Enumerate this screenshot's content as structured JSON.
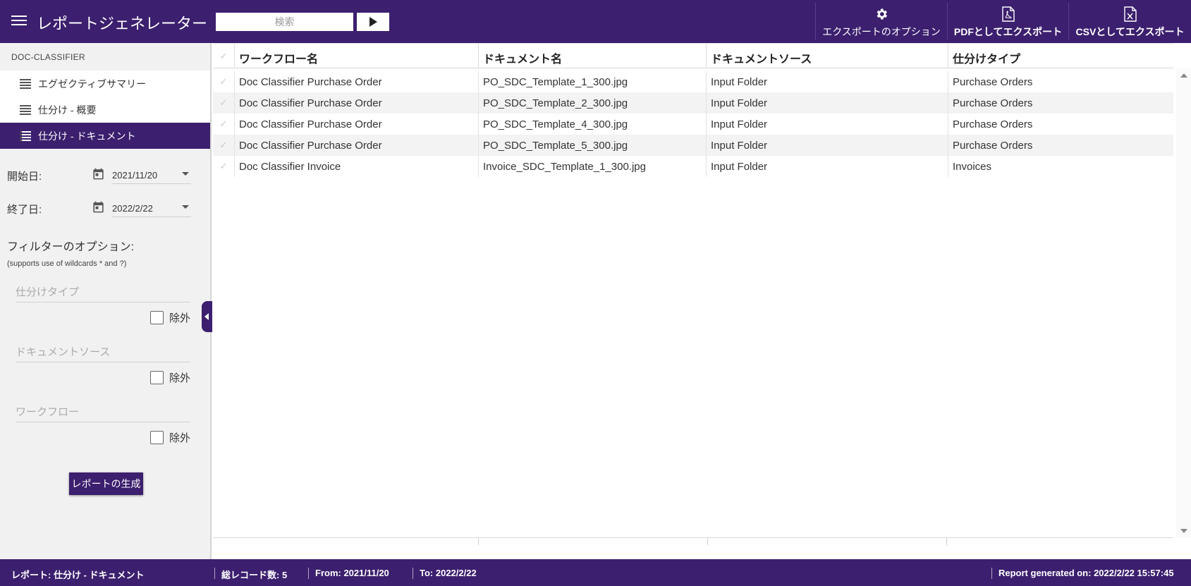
{
  "header": {
    "title": "レポートジェネレーター",
    "search_placeholder": "検索",
    "export_options_label": "エクスポートのオプション",
    "export_pdf_label": "PDFとしてエクスポート",
    "export_csv_label": "CSVとしてエクスポート"
  },
  "sidebar": {
    "section_label": "DOC-CLASSIFIER",
    "items": [
      {
        "label": "エグゼクティブサマリー"
      },
      {
        "label": "仕分け - 概要"
      },
      {
        "label": "仕分け - ドキュメント",
        "active": true
      }
    ],
    "start_label": "開始日:",
    "start_value": "2021/11/20",
    "end_label": "終了日:",
    "end_value": "2022/2/22",
    "filter_title": "フィルターのオプション:",
    "filter_hint": "(supports use of wildcards * and ?)",
    "filters": [
      {
        "placeholder": "仕分けタイプ",
        "exclude_label": "除外"
      },
      {
        "placeholder": "ドキュメントソース",
        "exclude_label": "除外"
      },
      {
        "placeholder": "ワークフロー",
        "exclude_label": "除外"
      }
    ],
    "generate_label": "レポートの生成"
  },
  "table": {
    "columns": [
      "ワークフロー名",
      "ドキュメント名",
      "ドキュメントソース",
      "仕分けタイプ"
    ],
    "rows": [
      [
        "Doc Classifier Purchase Order",
        "PO_SDC_Template_1_300.jpg",
        "Input Folder",
        "Purchase Orders"
      ],
      [
        "Doc Classifier Purchase Order",
        "PO_SDC_Template_2_300.jpg",
        "Input Folder",
        "Purchase Orders"
      ],
      [
        "Doc Classifier Purchase Order",
        "PO_SDC_Template_4_300.jpg",
        "Input Folder",
        "Purchase Orders"
      ],
      [
        "Doc Classifier Purchase Order",
        "PO_SDC_Template_5_300.jpg",
        "Input Folder",
        "Purchase Orders"
      ],
      [
        "Doc Classifier Invoice",
        "Invoice_SDC_Template_1_300.jpg",
        "Input Folder",
        "Invoices"
      ]
    ]
  },
  "status": {
    "report": "レポート: 仕分け - ドキュメント",
    "total": "総レコード数: 5",
    "from": "From: 2021/11/20",
    "to": "To: 2022/2/22",
    "generated": "Report generated on: 2022/2/22 15:57:45"
  },
  "colors": {
    "primary": "#3c1f6e",
    "row_alt": "#f3f3f3"
  }
}
